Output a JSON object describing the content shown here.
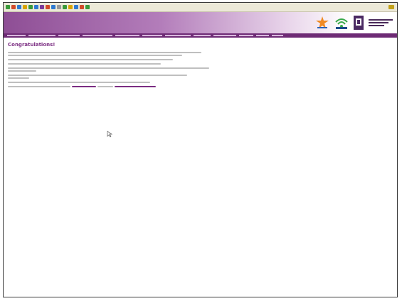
{
  "browser": {
    "toolbar_button_colors": [
      "#3a9a3a",
      "#d24a2a",
      "#2f7ad0",
      "#d9a400",
      "#3a9a3a",
      "#2f7ad0",
      "#7b3a9a",
      "#d24a2a",
      "#2f7ad0",
      "#999999",
      "#3a9a3a",
      "#d9a400",
      "#2f7ad0",
      "#d24a2a",
      "#3a9a3a"
    ]
  },
  "header": {
    "site_title": "",
    "top_link": ""
  },
  "nav": {
    "items": [
      "",
      "",
      "",
      "",
      "",
      "",
      "",
      "",
      "",
      "",
      "",
      ""
    ]
  },
  "content": {
    "heading": "Congratulations!",
    "paragraphs": [
      "",
      "",
      "",
      "",
      "",
      ""
    ],
    "final_text_before": "",
    "final_link_1": "",
    "final_text_mid": "",
    "final_link_2": ""
  },
  "colors": {
    "brand_purple": "#7b2d82",
    "nav_purple": "#6e2b75"
  }
}
